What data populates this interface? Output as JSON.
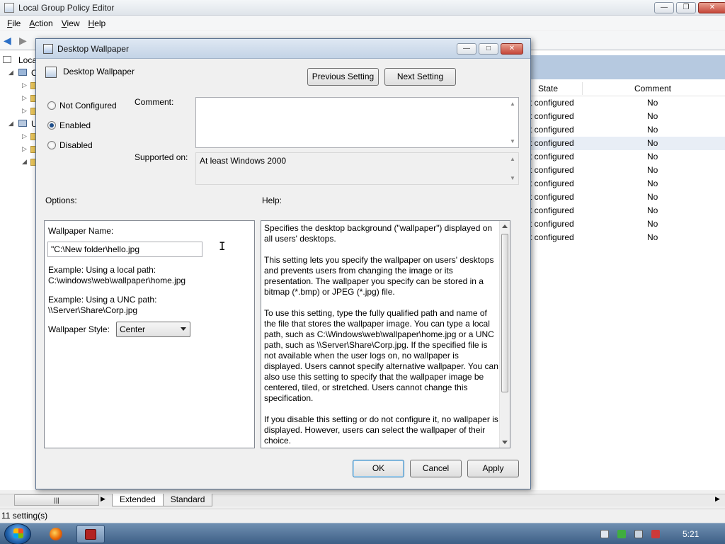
{
  "main_window": {
    "title": "Local Group Policy Editor",
    "menu": [
      "File",
      "Action",
      "View",
      "Help"
    ],
    "tree_labels": [
      "Local",
      "C",
      "U"
    ],
    "list": {
      "columns": [
        "State",
        "Comment"
      ],
      "rows": [
        {
          "state": "t configured",
          "comment": "No"
        },
        {
          "state": "t configured",
          "comment": "No"
        },
        {
          "state": "t configured",
          "comment": "No"
        },
        {
          "state": "t configured",
          "comment": "No"
        },
        {
          "state": "t configured",
          "comment": "No"
        },
        {
          "state": "t configured",
          "comment": "No"
        },
        {
          "state": "t configured",
          "comment": "No"
        },
        {
          "state": "t configured",
          "comment": "No"
        },
        {
          "state": "t configured",
          "comment": "No"
        },
        {
          "state": "t configured",
          "comment": "No"
        },
        {
          "state": "t configured",
          "comment": "No"
        }
      ]
    },
    "tabs": [
      "Extended",
      "Standard"
    ],
    "status": "11 setting(s)"
  },
  "dialog": {
    "title": "Desktop Wallpaper",
    "heading": "Desktop Wallpaper",
    "prev_button": "Previous Setting",
    "next_button": "Next Setting",
    "radios": [
      {
        "label": "Not Configured",
        "checked": false
      },
      {
        "label": "Enabled",
        "checked": true
      },
      {
        "label": "Disabled",
        "checked": false
      }
    ],
    "comment_label": "Comment:",
    "supported_label": "Supported on:",
    "supported_value": "At least Windows 2000",
    "options_label": "Options:",
    "help_label": "Help:",
    "options": {
      "wallpaper_name_label": "Wallpaper Name:",
      "wallpaper_name_value": "\"C:\\New folder\\hello.jpg",
      "example_local_label": "Example: Using a local path:",
      "example_local_value": "C:\\windows\\web\\wallpaper\\home.jpg",
      "example_unc_label": "Example: Using a UNC path:",
      "example_unc_value": "\\\\Server\\Share\\Corp.jpg",
      "style_label": "Wallpaper Style:",
      "style_value": "Center"
    },
    "help_paragraphs": [
      "Specifies the desktop background (\"wallpaper\") displayed on all users' desktops.",
      "This setting lets you specify the wallpaper on users' desktops and prevents users from changing the image or its presentation. The wallpaper you specify can be stored in a bitmap (*.bmp) or JPEG (*.jpg) file.",
      "To use this setting, type the fully qualified path and name of the file that stores the wallpaper image. You can type a local path, such as C:\\Windows\\web\\wallpaper\\home.jpg or a UNC path, such as \\\\Server\\Share\\Corp.jpg. If the specified file is not available when the user logs on, no wallpaper is displayed. Users cannot specify alternative wallpaper. You can also use this setting to specify that the wallpaper image be centered, tiled, or stretched. Users cannot change this specification.",
      "If you disable this setting or do not configure it, no wallpaper is displayed. However, users can select the wallpaper of their choice."
    ],
    "ok_button": "OK",
    "cancel_button": "Cancel",
    "apply_button": "Apply"
  },
  "taskbar": {
    "clock": "5:21"
  },
  "colors": {
    "selection_row": "#e8eef6",
    "header_band": "#b6c9e0",
    "taskbar": "#3d5f86"
  }
}
